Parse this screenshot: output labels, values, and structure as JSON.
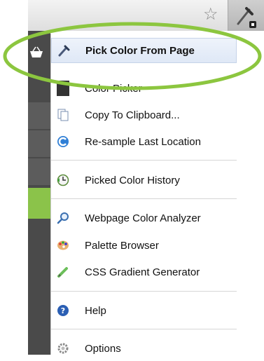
{
  "colors": {
    "highlight_ellipse": "#8cc63f",
    "menu_highlight": "#dfe8f6",
    "left_strip": "#4a4a4a",
    "left_strip_green": "#8bc34a"
  },
  "toolbar": {
    "bookmark_icon": "star-icon",
    "extension_icon": "eyedropper-icon"
  },
  "menu": {
    "items": [
      {
        "label": "Pick Color From Page",
        "icon": "eyedropper-icon"
      },
      {
        "label": "Color Picker",
        "icon": "color-swatch-icon"
      },
      {
        "label": "Copy To Clipboard...",
        "icon": "clipboard-icon"
      },
      {
        "label": "Re-sample Last Location",
        "icon": "refresh-icon"
      },
      {
        "label": "Picked Color History",
        "icon": "history-icon"
      },
      {
        "label": "Webpage Color Analyzer",
        "icon": "magnifier-icon"
      },
      {
        "label": "Palette Browser",
        "icon": "palette-icon"
      },
      {
        "label": "CSS Gradient Generator",
        "icon": "pencil-icon"
      },
      {
        "label": "Help",
        "icon": "help-icon"
      },
      {
        "label": "Options",
        "icon": "gear-icon"
      }
    ]
  }
}
